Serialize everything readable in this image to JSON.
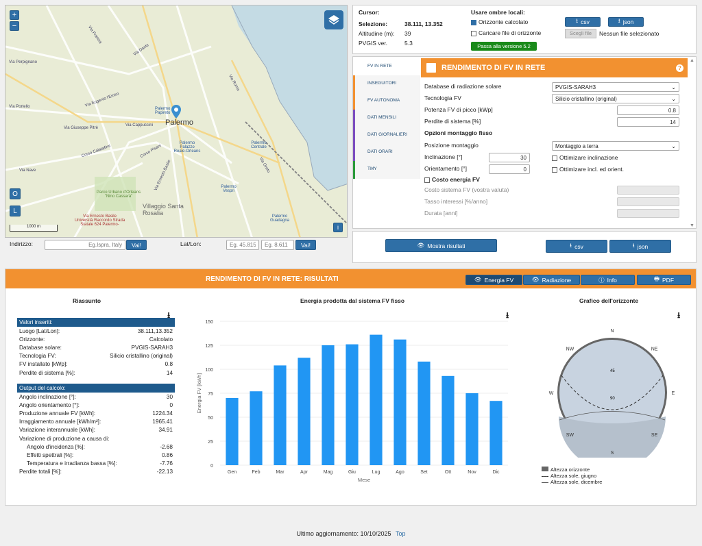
{
  "map": {
    "zoom_in": "+",
    "zoom_out": "−",
    "btn_o": "O",
    "btn_l": "L",
    "scale": "1000 m",
    "info": "i",
    "city": "Palermo",
    "labels": [
      "Via Francia",
      "Via Dante",
      "Via Perpignano",
      "Via Portello",
      "Via Giuseppe Pitrè",
      "Via Cappuccini",
      "Via Nave",
      "Corso Calatafimi",
      "Corso Pisani",
      "Via Ernesto Basile",
      "Parco Urbano d'Orleans \"Nino Cassarà\"",
      "Villaggio Santa Rosalia",
      "Palermo Palazzo Reale-Orleans",
      "Palermo Centrale",
      "Palermo Vespri",
      "Palermo Guadagna",
      "Palermo Papireto",
      "Via Eugenio l'Emiro",
      "Via Roma",
      "Via Oreto",
      "Via Ernesto Basile Università Raccordo Strada Statale 624 Palermo-"
    ]
  },
  "address": {
    "label": "Indirizzo:",
    "placeholder": "Eg.Ispra, Italy",
    "go": "Vai!",
    "latlon_label": "Lat/Lon:",
    "lat_ph": "Eg. 45.815",
    "lon_ph": "Eg. 8.611"
  },
  "cursor": {
    "title": "Cursor:",
    "sel_label": "Selezione:",
    "sel_val": "38.111, 13.352",
    "alt_label": "Altitudine (m):",
    "alt_val": "39",
    "ver_label": "PVGIS ver.",
    "ver_val": "5.3",
    "shadows": "Usare ombre locali:",
    "calc": "Orizzonte calcolato",
    "upload": "Caricare file di orizzonte",
    "csv": "csv",
    "json": "json",
    "choose": "Scegli file",
    "nofile": "Nessun file selezionato",
    "switch": "Passa alla versione 5.2"
  },
  "tabs": [
    "FV IN RETE",
    "INSEGUITORI",
    "FV AUTONOMA",
    "DATI MENSILI",
    "DATI GIORNALIERI",
    "DATI ORARI",
    "TMY"
  ],
  "form": {
    "header": "RENDIMENTO DI FV IN RETE",
    "db_label": "Database di radiazione solare",
    "db_val": "PVGIS-SARAH3",
    "tech_label": "Tecnologia FV",
    "tech_val": "Silicio cristallino (original)",
    "power_label": "Potenza FV di picco [kWp]",
    "power_val": "0.8",
    "loss_label": "Perdite di sistema [%]",
    "loss_val": "14",
    "fixed": "Opzioni montaggio fisso",
    "pos_label": "Posizione montaggio",
    "pos_val": "Montaggio a terra",
    "incl_label": "Inclinazione [°]",
    "incl_val": "30",
    "orient_label": "Orientamento [°]",
    "orient_val": "0",
    "opt_incl": "Ottimizare inclinazione",
    "opt_both": "Ottimizare incl. ed orient.",
    "cost": "Costo energia FV",
    "cost_sys": "Costo sistema FV (vostra valuta)",
    "rate": "Tasso interessi [%/anno]",
    "life": "Durata [anni]",
    "show": "Mostra risultati",
    "csv": "csv",
    "json": "json"
  },
  "results": {
    "header": "RENDIMENTO DI FV IN RETE: RISULTATI",
    "energy": "Energia FV",
    "rad": "Radiazione",
    "info": "Info",
    "pdf": "PDF"
  },
  "summary": {
    "title": "Riassunto",
    "inputs_title": "Valori inseriti:",
    "inputs": [
      [
        "Luogo [Lat/Lon]:",
        "38.111,13.352"
      ],
      [
        "Orizzonte:",
        "Calcolato"
      ],
      [
        "Database solare:",
        "PVGIS-SARAH3"
      ],
      [
        "Tecnologia FV:",
        "Silicio cristallino (original)"
      ],
      [
        "FV installato [kWp]:",
        "0.8"
      ],
      [
        "Perdite di sistema [%]:",
        "14"
      ]
    ],
    "output_title": "Output del calcolo:",
    "outputs": [
      [
        "Angolo inclinazione [°]:",
        "30"
      ],
      [
        "Angolo orientamento [°]:",
        "0"
      ],
      [
        "Produzione annuale FV [kWh]:",
        "1224.34"
      ],
      [
        "Irraggiamento annuale [kWh/m²]:",
        "1965.41"
      ],
      [
        "Variazione interannuale [kWh]:",
        "34.91"
      ],
      [
        "Variazione di produzione a causa di:",
        ""
      ]
    ],
    "sub": [
      [
        "Angolo d'incidenza [%]:",
        "-2.68"
      ],
      [
        "Effetti spettrali [%]:",
        "0.86"
      ],
      [
        "Temperatura e irradianza bassa [%]:",
        "-7.76"
      ]
    ],
    "total": [
      "Perdite totali [%]:",
      "-22.13"
    ]
  },
  "chart_title": "Energia prodotta dal sistema FV fisso",
  "chart_data": {
    "type": "bar",
    "categories": [
      "Gen",
      "Feb",
      "Mar",
      "Apr",
      "Mag",
      "Giu",
      "Lug",
      "Ago",
      "Set",
      "Ott",
      "Nov",
      "Dic"
    ],
    "values": [
      70,
      77,
      104,
      112,
      125,
      126,
      136,
      131,
      108,
      93,
      75,
      67
    ],
    "xlabel": "Mese",
    "ylabel": "Energia FV [kWh]",
    "ylim": [
      0,
      150
    ],
    "yticks": [
      0,
      25,
      50,
      75,
      100,
      125,
      150
    ],
    "color": "#2196f3"
  },
  "horizon": {
    "title": "Grafico dell'orizzonte",
    "dirs": [
      "N",
      "NE",
      "E",
      "SE",
      "S",
      "SW",
      "W",
      "NW"
    ],
    "r45": "45",
    "r90": "90",
    "leg1": "Altezza orizzonte",
    "leg2": "Altezza sole, giugno",
    "leg3": "Altezza sole, dicembre"
  },
  "footer": {
    "updated": "Ultimo aggiornamento: 10/10/2025",
    "top": "Top"
  },
  "colors": {
    "orange": "#f29130",
    "blue": "#2f6fa6",
    "bar": "#2196f3"
  }
}
